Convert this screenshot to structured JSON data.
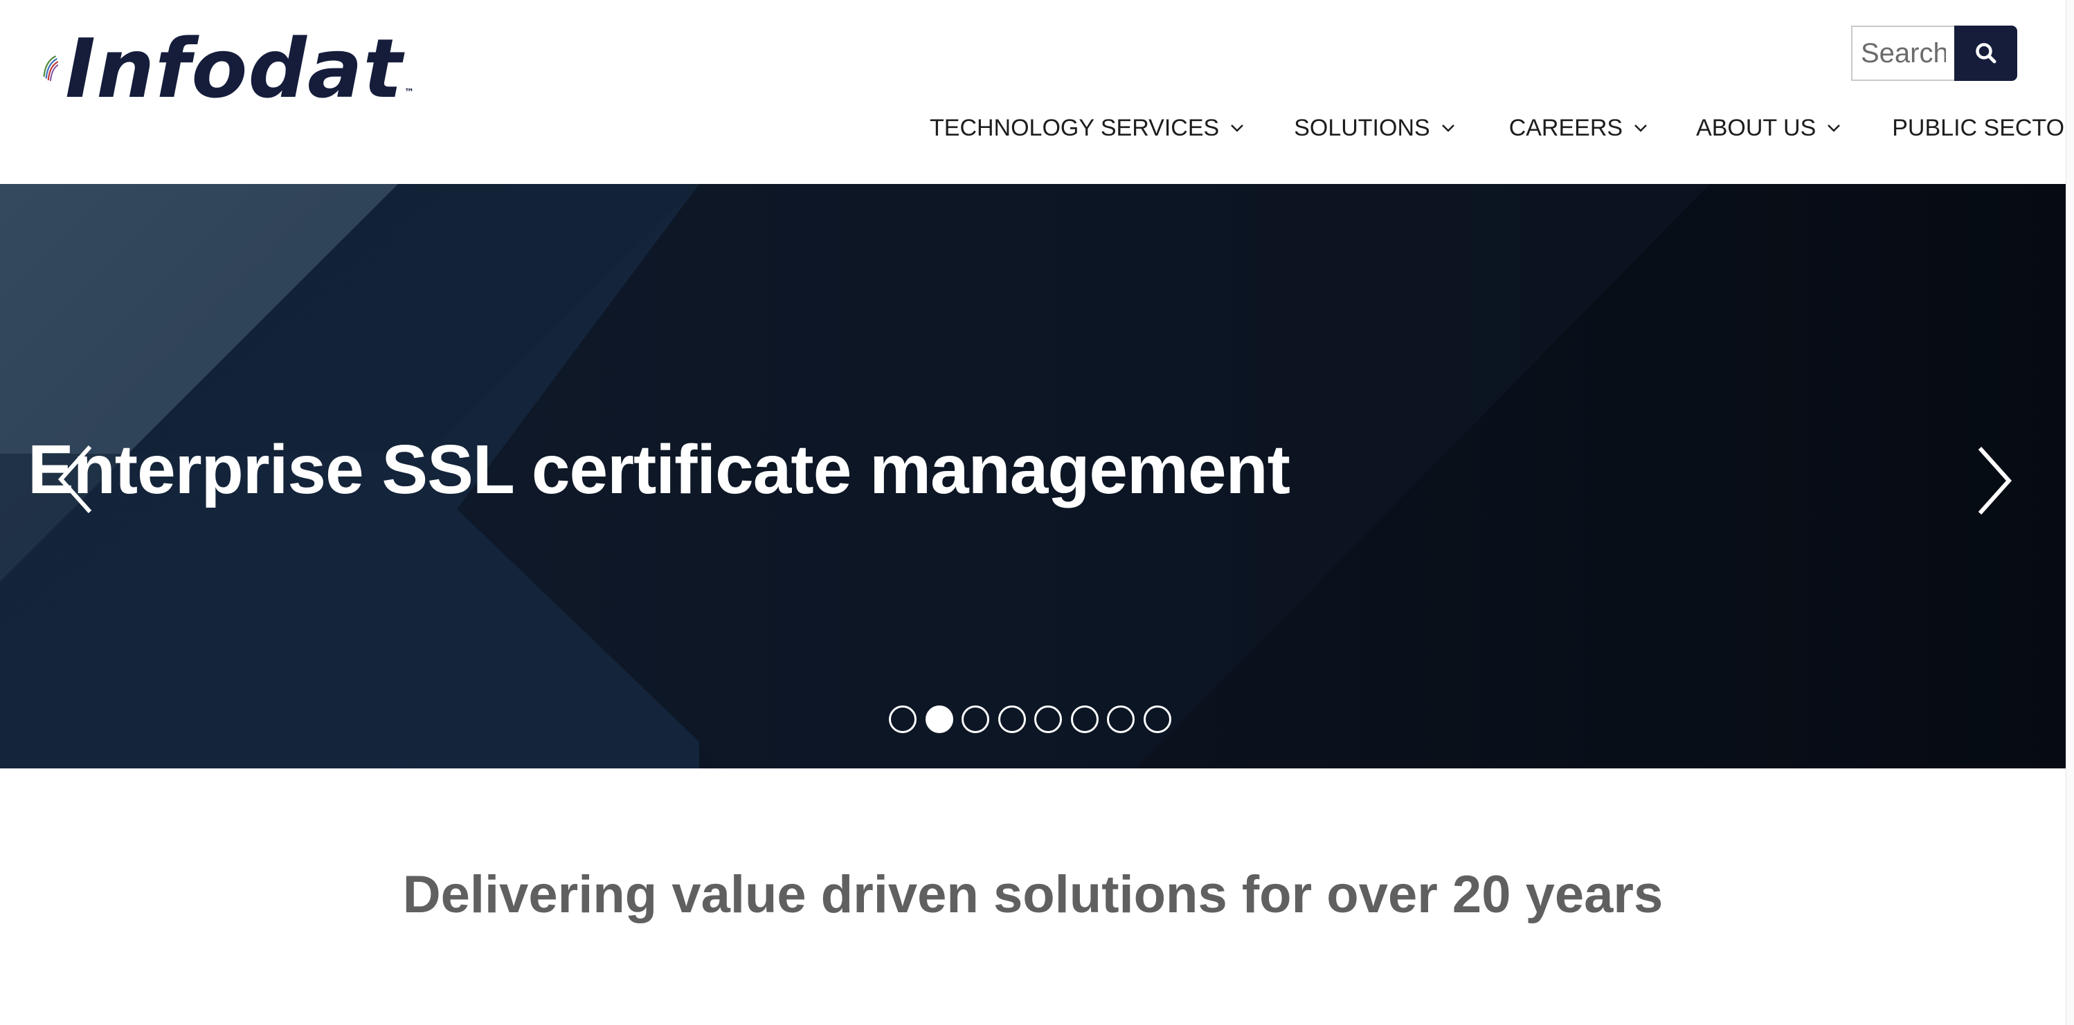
{
  "header": {
    "logo_text": "Infodat",
    "logo_tm": "™",
    "search": {
      "placeholder": "Search"
    },
    "nav": [
      {
        "label": "TECHNOLOGY SERVICES",
        "has_dropdown": true
      },
      {
        "label": "SOLUTIONS",
        "has_dropdown": true
      },
      {
        "label": "CAREERS",
        "has_dropdown": true
      },
      {
        "label": "ABOUT US",
        "has_dropdown": true
      },
      {
        "label": "PUBLIC SECTOR",
        "has_dropdown": false
      }
    ]
  },
  "hero": {
    "title": "Enterprise SSL certificate management",
    "slide_count": 8,
    "active_slide": 2
  },
  "tagline": "Delivering value driven solutions for over 20 years",
  "icons": {
    "search": "search-icon",
    "prev": "chevron-left-icon",
    "next": "chevron-right-icon",
    "dropdown": "chevron-down-icon"
  },
  "colors": {
    "brand_navy": "#151d3b",
    "hero_dark": "#0f1726",
    "text_gray": "#606060"
  }
}
